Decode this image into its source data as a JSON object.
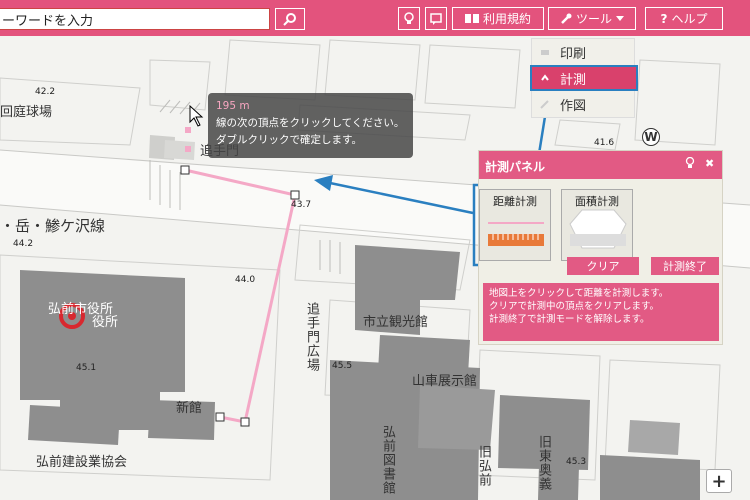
{
  "search": {
    "value": "ーワードを入力"
  },
  "toolbar": {
    "terms_label": "利用規約",
    "tools_label": "ツール",
    "help_label": "ヘルプ"
  },
  "tools_menu": {
    "items": [
      {
        "label": "印刷",
        "icon": "print-icon"
      },
      {
        "label": "計測",
        "icon": "chevron-up-icon"
      },
      {
        "label": "作図",
        "icon": "pencil-icon"
      }
    ]
  },
  "tooltip": {
    "distance": "195 m",
    "line1": "線の次の頂点をクリックしてください。",
    "line2": "ダブルクリックで確定します。"
  },
  "panel": {
    "title": "計測パネル",
    "mode_distance": "距離計測",
    "mode_area": "面積計測",
    "clear_button": "クリア",
    "end_button": "計測終了",
    "help_lines": [
      "地図上をクリックして距離を計測します。",
      "クリアで計測中の頂点をクリアします。",
      "計測終了で計測モードを解除します。"
    ]
  },
  "map": {
    "labels": {
      "garden_field": "回庭球場",
      "road_name": "・岳・鯵ケ沢線",
      "city_hall_a": "弘前市役所",
      "city_hall_b": "役所",
      "new_building": "新館",
      "kenchiku": "弘前建設業協会",
      "kankoukan": "市立観光館",
      "dashi": "山車展示館",
      "otemon_plaza": "追手門広場",
      "otemon_top": "追手門",
      "library": "弘前図書館",
      "old_library": "旧弘前",
      "old_east": "旧東奥義",
      "w_mark": "W"
    },
    "elevations": [
      "42.2",
      "42.7",
      "41.6",
      "43.7",
      "44.2",
      "44.0",
      "45.1",
      "45.5",
      "45.3"
    ]
  },
  "colors": {
    "accent": "#e3537d",
    "highlight_border": "#2a7fc0",
    "measure_line": "#f4a8c6"
  }
}
